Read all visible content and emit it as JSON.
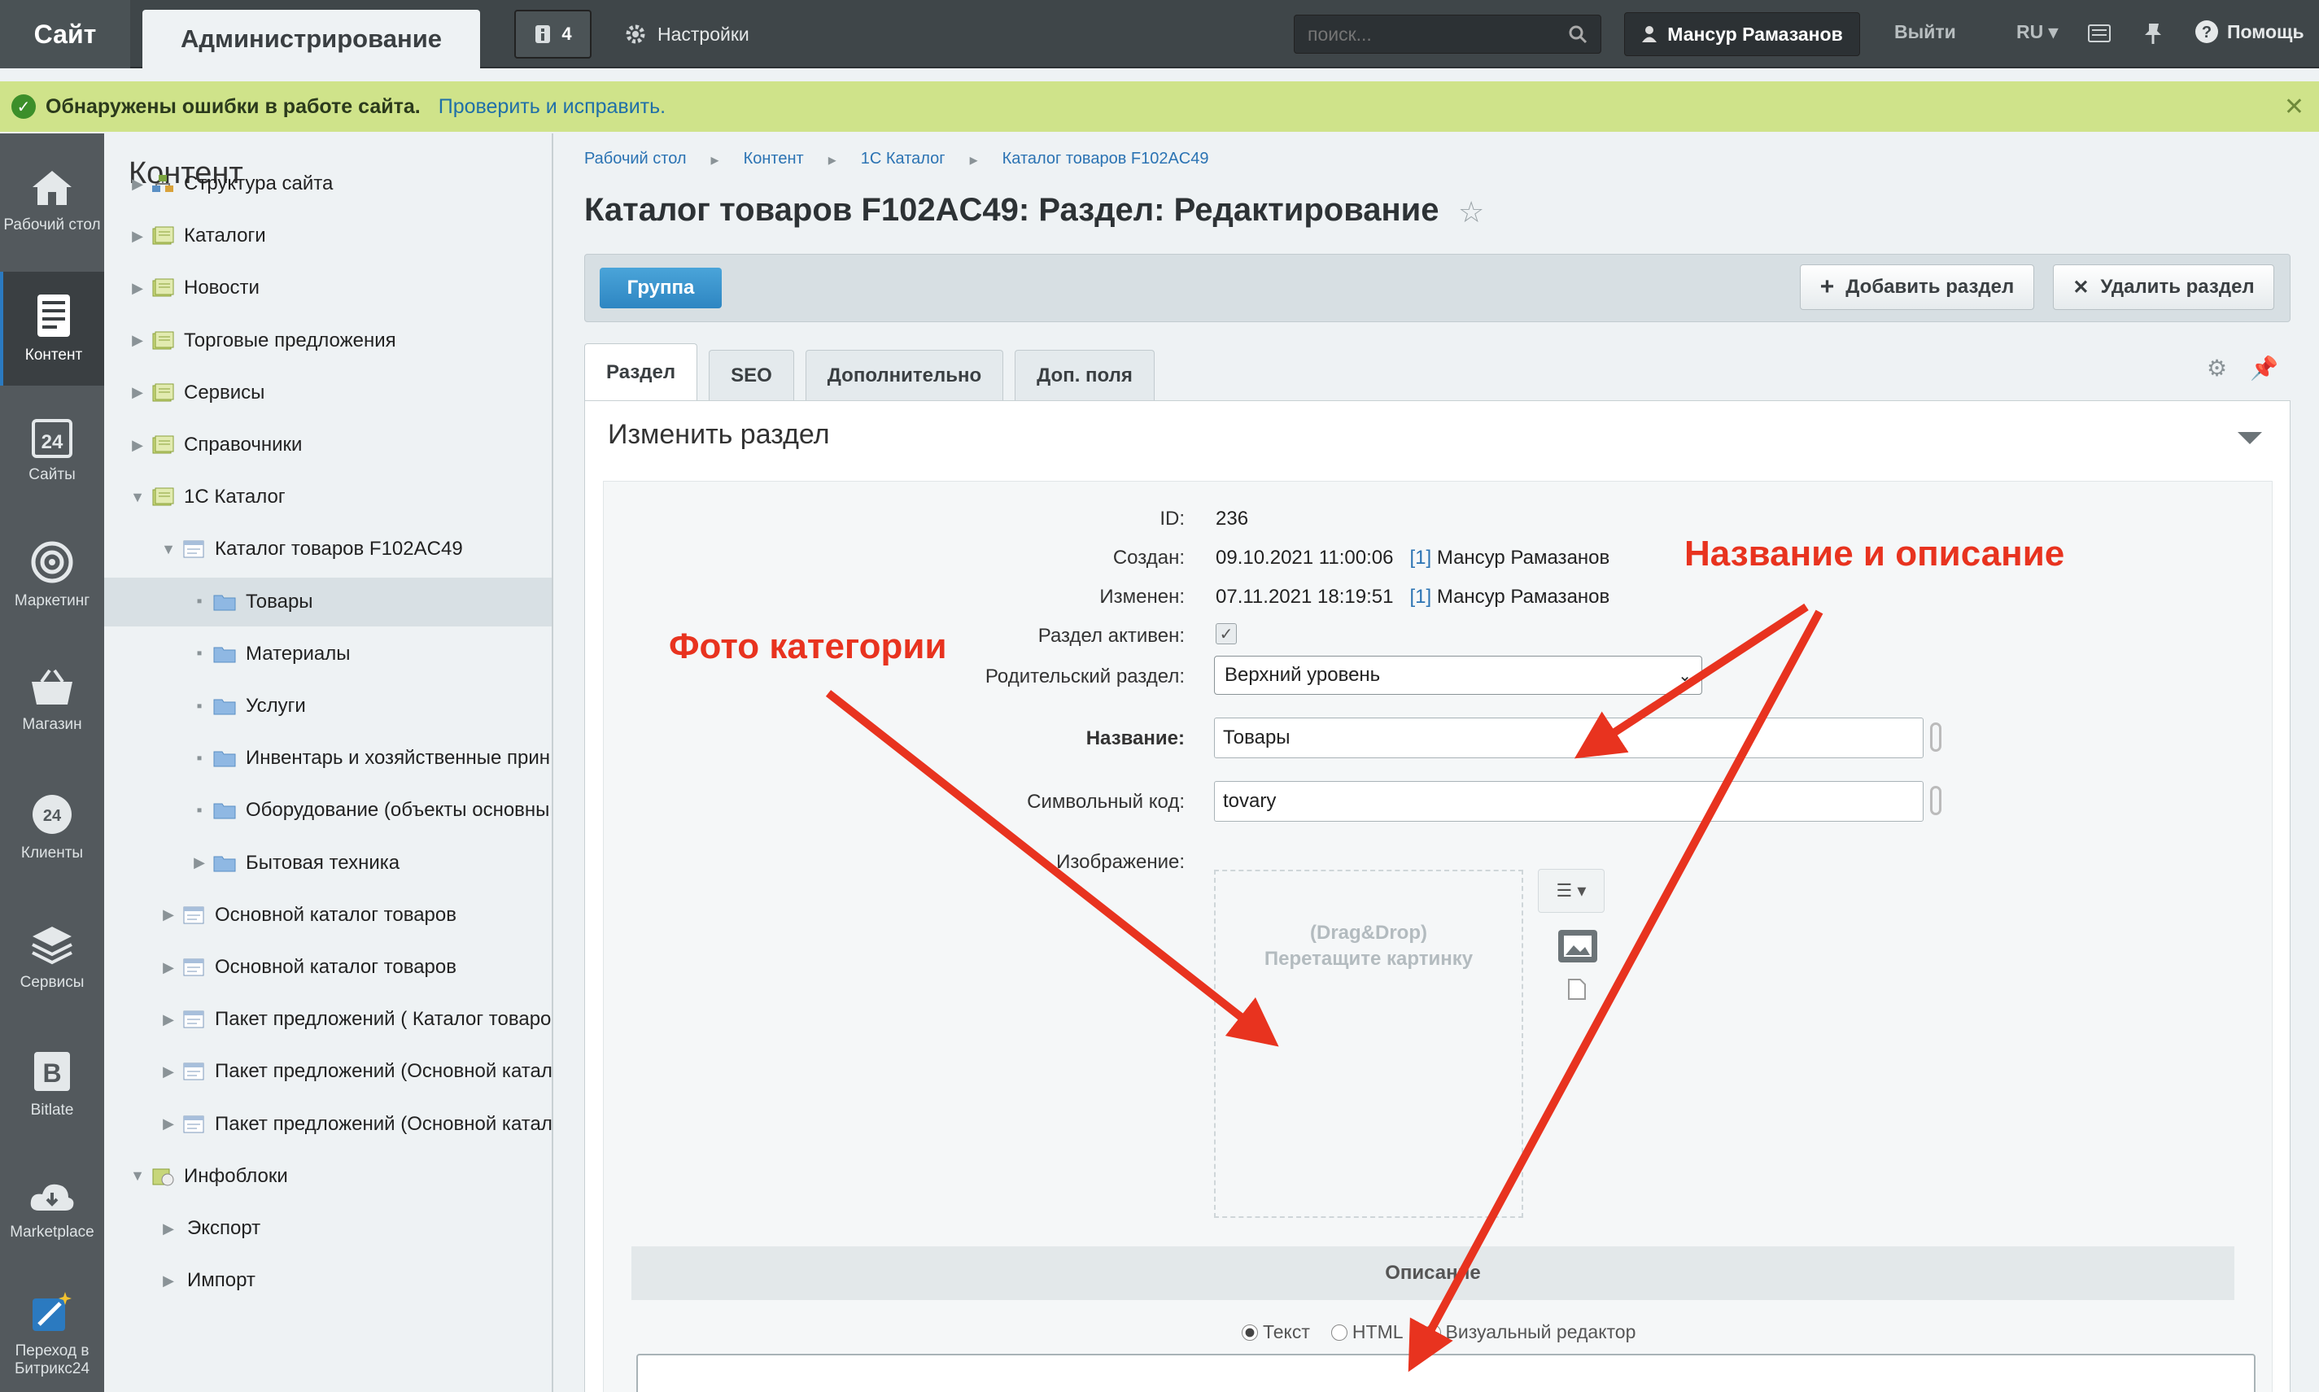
{
  "topbar": {
    "site": "Сайт",
    "admin": "Администрирование",
    "notifications_count": "4",
    "settings": "Настройки",
    "search_placeholder": "поиск...",
    "user": "Мансур Рамазанов",
    "logout": "Выйти",
    "lang": "RU",
    "help": "Помощь"
  },
  "banner": {
    "message": "Обнаружены ошибки в работе сайта.",
    "link": "Проверить и исправить."
  },
  "rail": [
    {
      "label": "Рабочий стол",
      "icon": "home-icon"
    },
    {
      "label": "Контент",
      "icon": "content-icon"
    },
    {
      "label": "Сайты",
      "icon": "sites-icon"
    },
    {
      "label": "Маркетинг",
      "icon": "target-icon"
    },
    {
      "label": "Магазин",
      "icon": "basket-icon"
    },
    {
      "label": "Клиенты",
      "icon": "clients-icon"
    },
    {
      "label": "Сервисы",
      "icon": "layers-icon"
    },
    {
      "label": "Bitlate",
      "icon": "bitlate-icon"
    },
    {
      "label": "Marketplace",
      "icon": "cloud-download-icon"
    },
    {
      "label": "Переход в Битрикс24",
      "icon": "magic-icon"
    }
  ],
  "tree": {
    "title": "Контент",
    "items": [
      "Структура сайта",
      "Каталоги",
      "Новости",
      "Торговые предложения",
      "Сервисы",
      "Справочники",
      "1С Каталог",
      "Каталог товаров F102AC49",
      "Товары",
      "Материалы",
      "Услуги",
      "Инвентарь и хозяйственные прин",
      "Оборудование (объекты основны",
      "Бытовая техника",
      "Основной каталог товаров",
      "Основной каталог товаров",
      "Пакет предложений ( Каталог товаро",
      "Пакет предложений (Основной катал",
      "Пакет предложений (Основной катал",
      "Инфоблоки",
      "Экспорт",
      "Импорт"
    ]
  },
  "breadcrumbs": [
    "Рабочий стол",
    "Контент",
    "1С Каталог",
    "Каталог товаров F102AC49"
  ],
  "page_title": "Каталог товаров F102AC49: Раздел: Редактирование",
  "toolbar": {
    "group": "Группа",
    "add": "Добавить раздел",
    "delete": "Удалить раздел"
  },
  "tabs": [
    "Раздел",
    "SEO",
    "Дополнительно",
    "Доп. поля"
  ],
  "panel_title": "Изменить раздел",
  "form": {
    "id_label": "ID:",
    "id_value": "236",
    "created_label": "Создан:",
    "created_value": "09.10.2021 11:00:06",
    "created_user_id": "[1]",
    "created_user": "Мансур Рамазанов",
    "modified_label": "Изменен:",
    "modified_value": "07.11.2021 18:19:51",
    "modified_user_id": "[1]",
    "modified_user": "Мансур Рамазанов",
    "active_label": "Раздел активен:",
    "parent_label": "Родительский раздел:",
    "parent_value": "Верхний уровень",
    "name_label": "Название:",
    "name_value": "Товары",
    "code_label": "Символьный код:",
    "code_value": "tovary",
    "image_label": "Изображение:",
    "drop_line1": "(Drag&Drop)",
    "drop_line2": "Перетащите картинку",
    "description_title": "Описание",
    "radio_text": "Текст",
    "radio_html": "HTML",
    "radio_visual": "Визуальный редактор"
  },
  "annotations": {
    "photo": "Фото категории",
    "name_desc": "Название и описание"
  },
  "colors": {
    "annotation": "#e8331f",
    "accent_blue": "#2e86c2",
    "banner": "#cfe38a"
  }
}
